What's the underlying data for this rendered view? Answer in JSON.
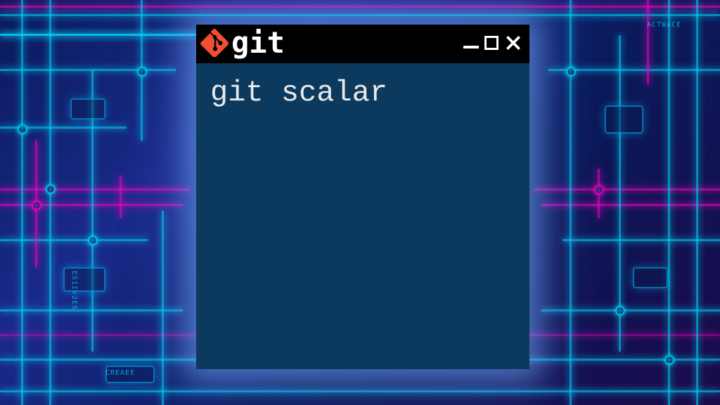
{
  "window": {
    "title": "git",
    "logo_name": "git-icon",
    "logo_color": "#f14e32"
  },
  "terminal": {
    "command": "git scalar",
    "background_color": "#0c3a5e",
    "text_color": "#e8e8e8"
  },
  "controls": {
    "minimize": "−",
    "maximize": "□",
    "close": "×"
  },
  "background": {
    "style": "circuit-board",
    "primary_glow": "#00c8ff",
    "secondary_glow": "#ff00c8"
  }
}
